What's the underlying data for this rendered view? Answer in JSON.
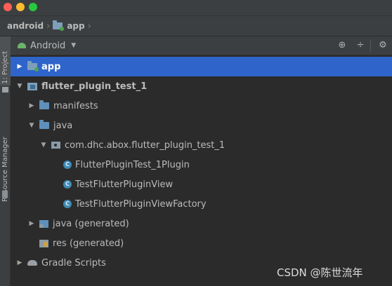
{
  "window": {
    "traffic_lights": [
      "#ff5f57",
      "#febc2e",
      "#28c840"
    ]
  },
  "breadcrumb": {
    "items": [
      "android",
      "app"
    ]
  },
  "left_strip": {
    "tabs": [
      "1: Project",
      "Resource Manager"
    ]
  },
  "panel": {
    "view_selector": "Android",
    "icons": [
      "crosshair-icon",
      "collapse-all-icon",
      "gear-icon"
    ]
  },
  "tree": {
    "items": [
      {
        "label": "app",
        "icon": "module-folder-icon",
        "arrow": "collapsed",
        "selected": true
      },
      {
        "label": "flutter_plugin_test_1",
        "icon": "module-folder-icon",
        "arrow": "expanded",
        "selected": false
      },
      {
        "label": "manifests",
        "icon": "folder-icon",
        "arrow": "collapsed",
        "selected": false
      },
      {
        "label": "java",
        "icon": "folder-icon",
        "arrow": "expanded",
        "selected": false
      },
      {
        "label": "com.dhc.abox.flutter_plugin_test_1",
        "icon": "package-icon",
        "arrow": "expanded",
        "selected": false
      },
      {
        "label": "FlutterPluginTest_1Plugin",
        "icon": "class-icon",
        "arrow": "none",
        "selected": false
      },
      {
        "label": "TestFlutterPluginView",
        "icon": "class-icon",
        "arrow": "none",
        "selected": false
      },
      {
        "label": "TestFlutterPluginViewFactory",
        "icon": "class-icon",
        "arrow": "none",
        "selected": false
      },
      {
        "label": "java (generated)",
        "icon": "generated-folder-icon",
        "arrow": "collapsed",
        "selected": false
      },
      {
        "label": "res (generated)",
        "icon": "resources-folder-icon",
        "arrow": "none",
        "selected": false
      },
      {
        "label": "Gradle Scripts",
        "icon": "gradle-icon",
        "arrow": "collapsed",
        "selected": false
      }
    ]
  },
  "watermark": "CSDN @陈世流年",
  "colors": {
    "selection": "#2f65ca",
    "background": "#2b2b2b",
    "panel": "#3c3f41"
  }
}
